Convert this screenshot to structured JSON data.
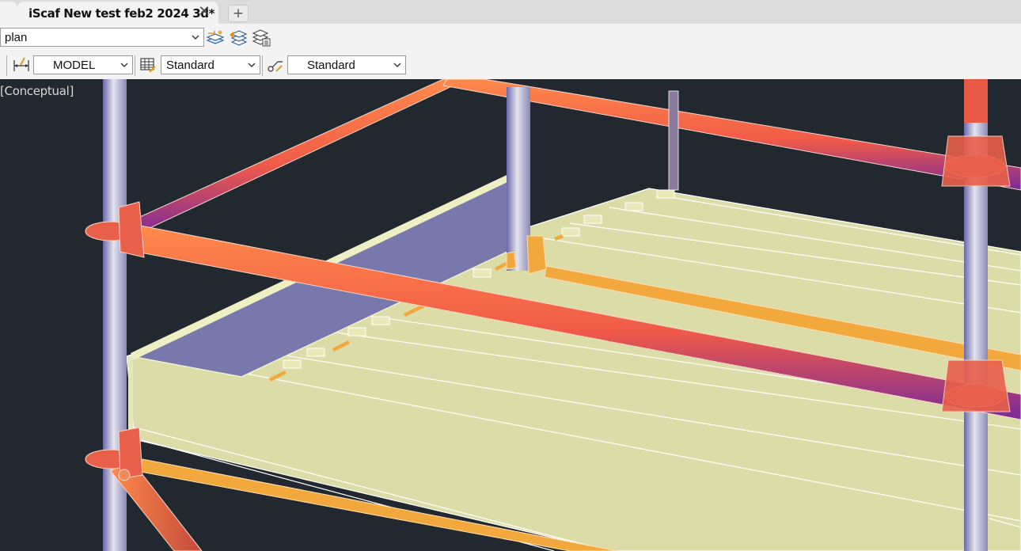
{
  "tabs": {
    "active_title": "iScaf New test feb2 2024 3d*",
    "close_glyph": "✕",
    "new_glyph": "+"
  },
  "toolbar_row1": {
    "layer_combo_value": "plan",
    "icons": [
      "layer-properties-icon",
      "layer-previous-icon",
      "layer-states-icon"
    ]
  },
  "toolbar_row2": {
    "space_combo_value": "MODEL",
    "table_style_value": "Standard",
    "multileader_style_value": "Standard",
    "icons": [
      "dimension-style-icon",
      "table-style-icon",
      "multileader-style-icon"
    ]
  },
  "viewport": {
    "visual_style_label": "[Conceptual]"
  },
  "colors": {
    "background": "#212830",
    "ledger": "#f26a44",
    "deck": "#dcdca8",
    "standard": "#c8c8d8",
    "kickboard": "#7878ac",
    "transom": "#f2a83c"
  }
}
